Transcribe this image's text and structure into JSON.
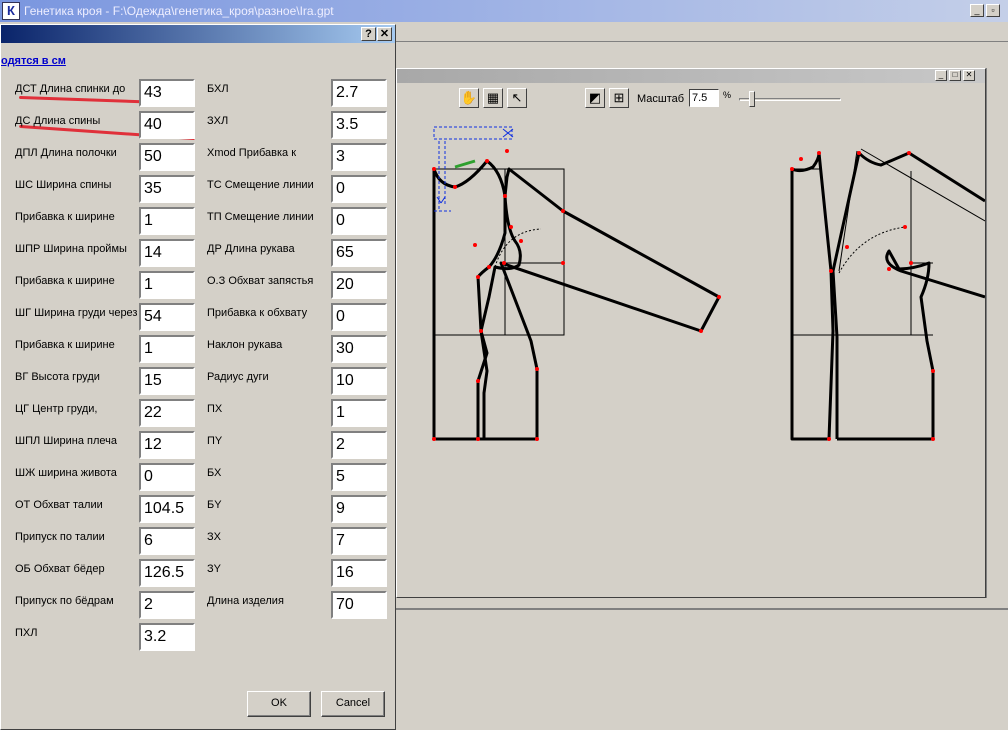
{
  "app": {
    "title": "Генетика кроя - F:\\Одежда\\генетика_кроя\\разное\\Ira.gpt",
    "icon_letter": "К"
  },
  "dialog": {
    "help_button": "?",
    "close_button": "✕",
    "units_text": "одятся в см",
    "ok_label": "OK",
    "cancel_label": "Cancel",
    "left_fields": [
      {
        "label": "ДСТ Длина спинки до",
        "value": "43"
      },
      {
        "label": "ДС Длина спины",
        "value": "40"
      },
      {
        "label": "ДПЛ Длина полочки",
        "value": "50"
      },
      {
        "label": "ШС Ширина спины",
        "value": "35"
      },
      {
        "label": "Прибавка к ширине",
        "value": "1"
      },
      {
        "label": "ШПР Ширина проймы",
        "value": "14"
      },
      {
        "label": "Прибавка к ширине",
        "value": "1"
      },
      {
        "label": "ШГ Ширина груди через",
        "value": "54"
      },
      {
        "label": "Прибавка к ширине",
        "value": "1"
      },
      {
        "label": "ВГ Высота груди",
        "value": "15"
      },
      {
        "label": "ЦГ Центр груди,",
        "value": "22"
      },
      {
        "label": "ШПЛ Ширина плеча",
        "value": "12"
      },
      {
        "label": "ШЖ ширина живота",
        "value": "0"
      },
      {
        "label": "ОТ Обхват талии",
        "value": "104.5"
      },
      {
        "label": "Припуск по талии",
        "value": "6"
      },
      {
        "label": "ОБ Обхват бёдер",
        "value": "126.5"
      },
      {
        "label": "Припуск по бёдрам",
        "value": "2"
      },
      {
        "label": "ПХЛ",
        "value": "3.2"
      }
    ],
    "right_fields": [
      {
        "label": "БХЛ",
        "value": "2.7"
      },
      {
        "label": "ЗХЛ",
        "value": "3.5"
      },
      {
        "label": "Xmod Прибавка к",
        "value": "3"
      },
      {
        "label": "ТС Смещение линии",
        "value": "0"
      },
      {
        "label": "ТП Смещение линии",
        "value": "0"
      },
      {
        "label": "ДР Длина рукава",
        "value": "65"
      },
      {
        "label": "О.З Обхват запястья",
        "value": "20"
      },
      {
        "label": "Прибавка к обхвату",
        "value": "0"
      },
      {
        "label": "Наклон рукава",
        "value": "30"
      },
      {
        "label": "Радиус дуги",
        "value": "10"
      },
      {
        "label": "ПХ",
        "value": "1"
      },
      {
        "label": "ПY",
        "value": "2"
      },
      {
        "label": "БХ",
        "value": "5"
      },
      {
        "label": "БY",
        "value": "9"
      },
      {
        "label": "ЗХ",
        "value": "7"
      },
      {
        "label": "ЗY",
        "value": "16"
      },
      {
        "label": "Длина изделия",
        "value": "70"
      }
    ]
  },
  "canvas": {
    "scale_label": "Масштаб",
    "scale_value": "7.5",
    "scale_unit": "%",
    "tools": [
      "hand-icon",
      "fit-page-icon",
      "cursor-arrow-icon",
      "zoom-icon",
      "zoom-123-icon"
    ],
    "tool_glyphs": [
      "✋",
      "▦",
      "↖",
      "◩",
      "⊞"
    ]
  },
  "colors": {
    "title_gradient_start": "#0a246a",
    "annotation_red": "#e0303a",
    "pattern_line": "#000000",
    "point_red": "#ff0000",
    "guide_blue": "#1030e0",
    "link_blue": "#0000cc"
  }
}
